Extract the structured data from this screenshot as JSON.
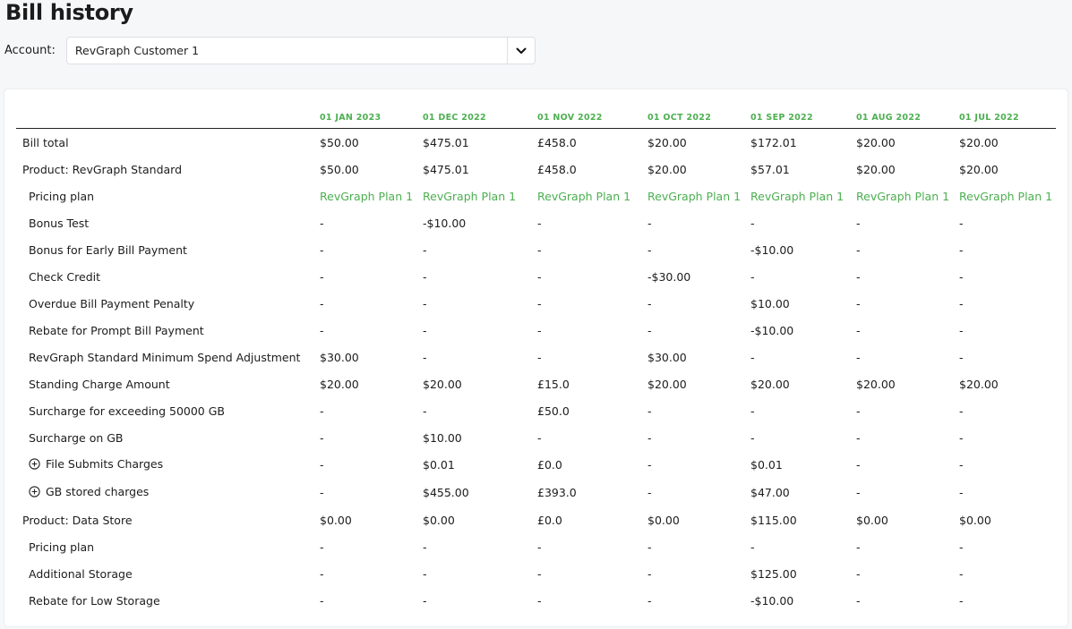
{
  "page": {
    "title": "Bill history"
  },
  "account": {
    "label": "Account:",
    "selected": "RevGraph Customer 1"
  },
  "colors": {
    "accent_green": "#4caf50",
    "text": "#1c1c1c"
  },
  "table": {
    "columns": [
      "01 JAN 2023",
      "01 DEC 2022",
      "01 NOV 2022",
      "01 OCT 2022",
      "01 SEP 2022",
      "01 AUG 2022",
      "01 JUL 2022"
    ],
    "rows": [
      {
        "label": "Bill total",
        "indent": false,
        "link": false,
        "expand": false,
        "values": [
          "$50.00",
          "$475.01",
          "£458.0",
          "$20.00",
          "$172.01",
          "$20.00",
          "$20.00"
        ]
      },
      {
        "label": "Product: RevGraph Standard",
        "indent": false,
        "link": false,
        "expand": false,
        "values": [
          "$50.00",
          "$475.01",
          "£458.0",
          "$20.00",
          "$57.01",
          "$20.00",
          "$20.00"
        ]
      },
      {
        "label": "Pricing plan",
        "indent": true,
        "link": true,
        "expand": false,
        "values": [
          "RevGraph Plan 1",
          "RevGraph Plan 1",
          "RevGraph Plan 1",
          "RevGraph Plan 1",
          "RevGraph Plan 1",
          "RevGraph Plan 1",
          "RevGraph Plan 1"
        ]
      },
      {
        "label": "Bonus Test",
        "indent": true,
        "link": false,
        "expand": false,
        "values": [
          "-",
          "-$10.00",
          "-",
          "-",
          "-",
          "-",
          "-"
        ]
      },
      {
        "label": "Bonus for Early Bill Payment",
        "indent": true,
        "link": false,
        "expand": false,
        "values": [
          "-",
          "-",
          "-",
          "-",
          "-$10.00",
          "-",
          "-"
        ]
      },
      {
        "label": "Check Credit",
        "indent": true,
        "link": false,
        "expand": false,
        "values": [
          "-",
          "-",
          "-",
          "-$30.00",
          "-",
          "-",
          "-"
        ]
      },
      {
        "label": "Overdue Bill Payment Penalty",
        "indent": true,
        "link": false,
        "expand": false,
        "values": [
          "-",
          "-",
          "-",
          "-",
          "$10.00",
          "-",
          "-"
        ]
      },
      {
        "label": "Rebate for Prompt Bill Payment",
        "indent": true,
        "link": false,
        "expand": false,
        "values": [
          "-",
          "-",
          "-",
          "-",
          "-$10.00",
          "-",
          "-"
        ]
      },
      {
        "label": "RevGraph Standard Minimum Spend Adjustment",
        "indent": true,
        "link": false,
        "expand": false,
        "values": [
          "$30.00",
          "-",
          "-",
          "$30.00",
          "-",
          "-",
          "-"
        ]
      },
      {
        "label": "Standing Charge Amount",
        "indent": true,
        "link": false,
        "expand": false,
        "values": [
          "$20.00",
          "$20.00",
          "£15.0",
          "$20.00",
          "$20.00",
          "$20.00",
          "$20.00"
        ]
      },
      {
        "label": "Surcharge for exceeding 50000 GB",
        "indent": true,
        "link": false,
        "expand": false,
        "values": [
          "-",
          "-",
          "£50.0",
          "-",
          "-",
          "-",
          "-"
        ]
      },
      {
        "label": "Surcharge on GB",
        "indent": true,
        "link": false,
        "expand": false,
        "values": [
          "-",
          "$10.00",
          "-",
          "-",
          "-",
          "-",
          "-"
        ]
      },
      {
        "label": "File Submits Charges",
        "indent": true,
        "link": false,
        "expand": true,
        "values": [
          "-",
          "$0.01",
          "£0.0",
          "-",
          "$0.01",
          "-",
          "-"
        ]
      },
      {
        "label": "GB stored charges",
        "indent": true,
        "link": false,
        "expand": true,
        "values": [
          "-",
          "$455.00",
          "£393.0",
          "-",
          "$47.00",
          "-",
          "-"
        ]
      },
      {
        "label": "Product: Data Store",
        "indent": false,
        "link": false,
        "expand": false,
        "values": [
          "$0.00",
          "$0.00",
          "£0.0",
          "$0.00",
          "$115.00",
          "$0.00",
          "$0.00"
        ]
      },
      {
        "label": "Pricing plan",
        "indent": true,
        "link": false,
        "expand": false,
        "values": [
          "-",
          "-",
          "-",
          "-",
          "-",
          "-",
          "-"
        ]
      },
      {
        "label": "Additional Storage",
        "indent": true,
        "link": false,
        "expand": false,
        "values": [
          "-",
          "-",
          "-",
          "-",
          "$125.00",
          "-",
          "-"
        ]
      },
      {
        "label": "Rebate for Low Storage",
        "indent": true,
        "link": false,
        "expand": false,
        "values": [
          "-",
          "-",
          "-",
          "-",
          "-$10.00",
          "-",
          "-"
        ]
      }
    ]
  }
}
